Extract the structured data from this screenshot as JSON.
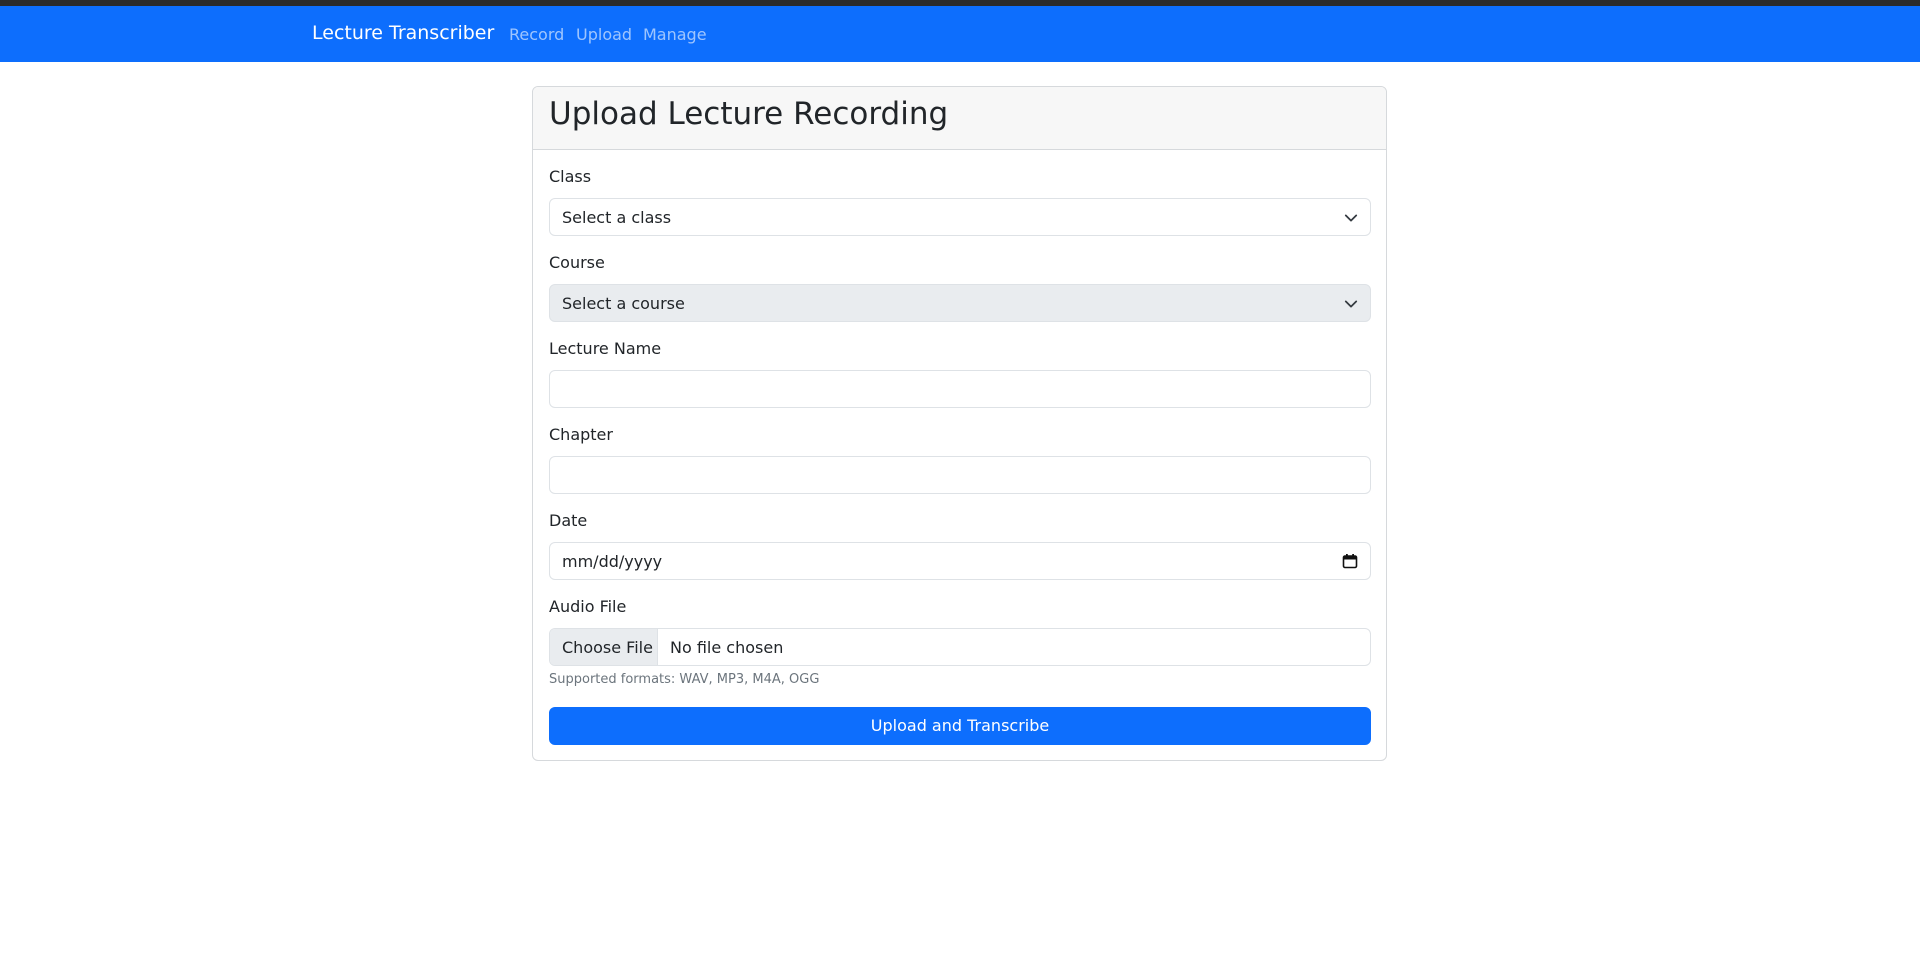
{
  "navbar": {
    "brand": "Lecture Transcriber",
    "links": [
      {
        "label": "Record"
      },
      {
        "label": "Upload"
      },
      {
        "label": "Manage"
      }
    ],
    "colors": {
      "background": "#0d6efd",
      "link": "rgba(255,255,255,0.6)"
    }
  },
  "card": {
    "title": "Upload Lecture Recording"
  },
  "form": {
    "class": {
      "label": "Class",
      "selected": "Select a class",
      "icon": "chevron-down-icon"
    },
    "course": {
      "label": "Course",
      "selected": "Select a course",
      "disabled": true,
      "icon": "chevron-down-icon"
    },
    "lecture_name": {
      "label": "Lecture Name",
      "value": ""
    },
    "chapter": {
      "label": "Chapter",
      "value": ""
    },
    "date": {
      "label": "Date",
      "placeholder": "mm/dd/yyyy",
      "icon": "calendar-icon"
    },
    "audio_file": {
      "label": "Audio File",
      "button": "Choose File",
      "status": "No file chosen",
      "help": "Supported formats: WAV, MP3, M4A, OGG"
    },
    "submit_label": "Upload and Transcribe"
  },
  "colors": {
    "primary": "#0d6efd",
    "disabled_bg": "#e9ecef",
    "muted_text": "#6c757d"
  }
}
